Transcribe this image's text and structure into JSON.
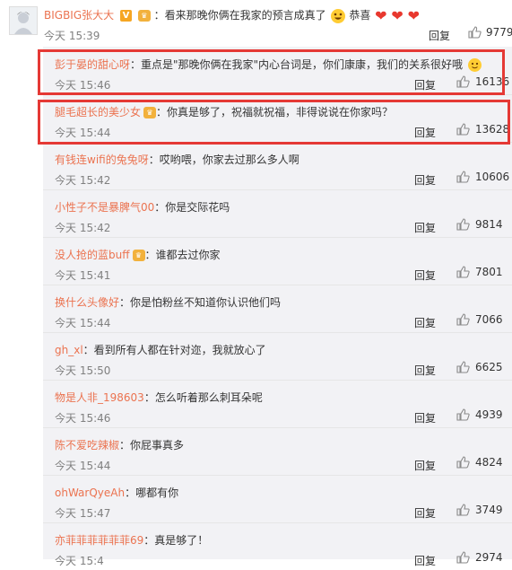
{
  "main_comment": {
    "username": "BIGBIG张大大",
    "verified_badge": "V",
    "text": "：看来那晚你俩在我家的预言成真了",
    "emoji_tail_text": "恭喜",
    "time": "今天 15:39",
    "reply_label": "回复",
    "likes": "9779",
    "icons": [
      "avatar",
      "verified-badge",
      "vip-badge",
      "grin-emoji",
      "heart-icon",
      "like-icon"
    ],
    "colors": {
      "username": "#eb7350",
      "heart": "#e8382e",
      "highlight": "#e53935",
      "reply_bg": "#f2f2f5"
    }
  },
  "replies": [
    {
      "username": "彭于晏的甜心呀",
      "text": "：重点是\"那晚你俩在我家\"内心台词是，你们康康，我们的关系很好哦",
      "time": "今天 15:46",
      "reply_label": "回复",
      "likes": "16136",
      "highlighted": true
    },
    {
      "username": "腿毛超长的美少女",
      "text": "：你真是够了，祝福就祝福，非得说说在你家吗？",
      "time": "今天 15:44",
      "reply_label": "回复",
      "likes": "13628",
      "highlighted": true
    },
    {
      "username": "有钱连wifi的兔兔呀",
      "text": "：哎哟喂，你家去过那么多人啊",
      "time": "今天 15:42",
      "reply_label": "回复",
      "likes": "10606"
    },
    {
      "username": "小性子不是暴脾气00",
      "text": "：你是交际花吗",
      "time": "今天 15:42",
      "reply_label": "回复",
      "likes": "9814"
    },
    {
      "username": "没人抢的蓝buff",
      "text": "：谁都去过你家",
      "time": "今天 15:41",
      "reply_label": "回复",
      "likes": "7801"
    },
    {
      "username": "换什么头像好",
      "text": "：你是怕粉丝不知道你认识他们吗",
      "time": "今天 15:44",
      "reply_label": "回复",
      "likes": "7066"
    },
    {
      "username": "gh_xl",
      "text": "：看到所有人都在针对迩，我就放心了",
      "time": "今天 15:50",
      "reply_label": "回复",
      "likes": "6625"
    },
    {
      "username": "物是人非_198603",
      "text": "：怎么听着那么刺耳朵呢",
      "time": "今天 15:46",
      "reply_label": "回复",
      "likes": "4939"
    },
    {
      "username": "陈不爱吃辣椒",
      "text": "：你屁事真多",
      "time": "今天 15:44",
      "reply_label": "回复",
      "likes": "4824"
    },
    {
      "username": "ohWarQyeAh",
      "text": "：哪都有你",
      "time": "今天 15:47",
      "reply_label": "回复",
      "likes": "3749"
    },
    {
      "username": "亦菲菲菲菲菲菲69",
      "text": "：真是够了！",
      "time": "今天 15:4",
      "reply_label": "回复",
      "likes": "2974"
    }
  ]
}
